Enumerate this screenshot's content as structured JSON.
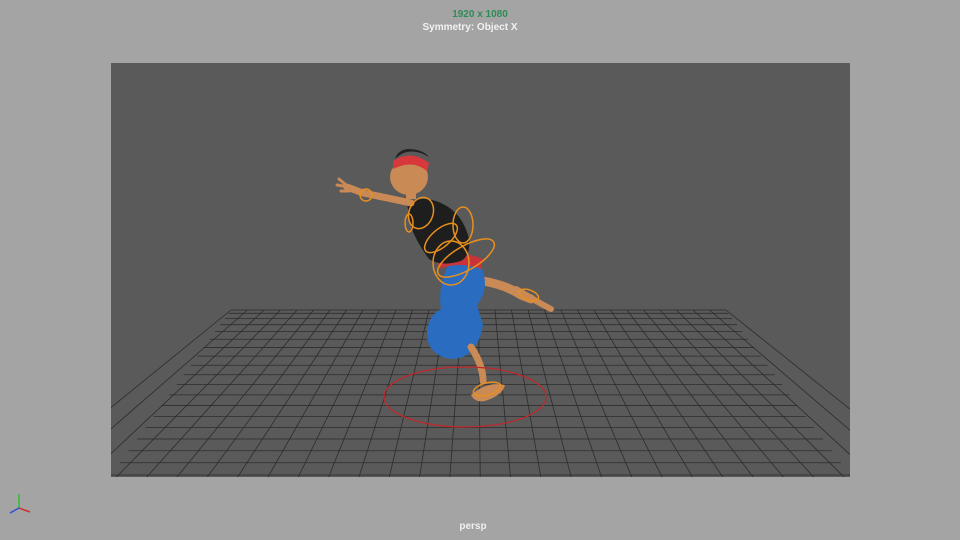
{
  "hud": {
    "resolution_text": "1920 x 1080",
    "symmetry_text": "Symmetry: Object X"
  },
  "viewport": {
    "camera_name": "persp"
  },
  "scene": {
    "character": "stylized-boy-character",
    "ground": "perspective-grid",
    "controls": [
      "torso-ik-controls",
      "foot-placement-circle"
    ]
  },
  "colors": {
    "viewport_background": "#a4a4a4",
    "gate_background": "#5a5a5a",
    "grid_lines": "#2c2c2c",
    "control_curves": "#e8901e",
    "foot_circle": "#c0282c",
    "headband": "#d8383c",
    "pants": "#2a6cc0",
    "shirt": "#1e1e1e",
    "skin": "#c98a55",
    "resolution_text": "#2e8b57",
    "axis_x": "#d03030",
    "axis_y": "#30c030",
    "axis_z": "#3050d0"
  },
  "axis_gizmo": {
    "icon": "xyz-axis-gizmo-icon"
  }
}
